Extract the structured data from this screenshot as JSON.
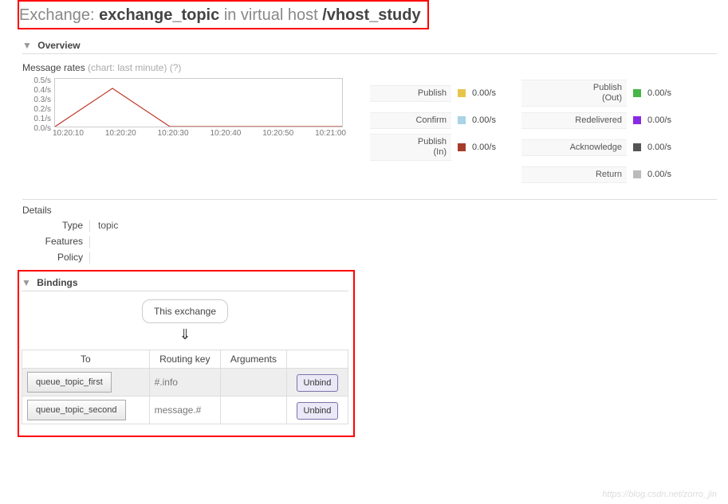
{
  "title": {
    "prefix": "Exchange:",
    "name": "exchange_topic",
    "mid": "in virtual host",
    "vhost": "/vhost_study"
  },
  "overview": {
    "label": "Overview",
    "mrates": {
      "label": "Message rates",
      "suffix": "(chart: last minute) (?)"
    }
  },
  "chart_data": {
    "type": "line",
    "x": [
      "10:20:10",
      "10:20:20",
      "10:20:30",
      "10:20:40",
      "10:20:50",
      "10:21:00"
    ],
    "values": [
      0,
      0.4,
      0,
      0,
      0,
      0
    ],
    "ylim": [
      0,
      0.5
    ],
    "yticks": [
      "0.5/s",
      "0.4/s",
      "0.3/s",
      "0.2/s",
      "0.1/s",
      "0.0/s"
    ],
    "series_color": "#c0392b"
  },
  "rates": {
    "left": [
      {
        "label": "Publish",
        "color": "#e6c54a",
        "value": "0.00/s"
      },
      {
        "label": "Confirm",
        "color": "#a8d4e6",
        "value": "0.00/s"
      },
      {
        "label": "Publish\n(In)",
        "color": "#a83a2a",
        "value": "0.00/s"
      }
    ],
    "right": [
      {
        "label": "Publish\n(Out)",
        "color": "#47b647",
        "value": "0.00/s"
      },
      {
        "label": "Redelivered",
        "color": "#8a2be2",
        "value": "0.00/s"
      },
      {
        "label": "Acknowledge",
        "color": "#555",
        "value": "0.00/s"
      },
      {
        "label": "Return",
        "color": "#bbb",
        "value": "0.00/s"
      }
    ]
  },
  "details": {
    "heading": "Details",
    "rows": [
      {
        "k": "Type",
        "v": "topic"
      },
      {
        "k": "Features",
        "v": ""
      },
      {
        "k": "Policy",
        "v": ""
      }
    ]
  },
  "bindings": {
    "label": "Bindings",
    "this_exchange": "This exchange",
    "arrow": "⇓",
    "headers": [
      "To",
      "Routing key",
      "Arguments",
      ""
    ],
    "rows": [
      {
        "to": "queue_topic_first",
        "rk": "#.info",
        "args": "",
        "action": "Unbind"
      },
      {
        "to": "queue_topic_second",
        "rk": "message.#",
        "args": "",
        "action": "Unbind"
      }
    ]
  },
  "watermark": "https://blog.csdn.net/zorro_jin"
}
